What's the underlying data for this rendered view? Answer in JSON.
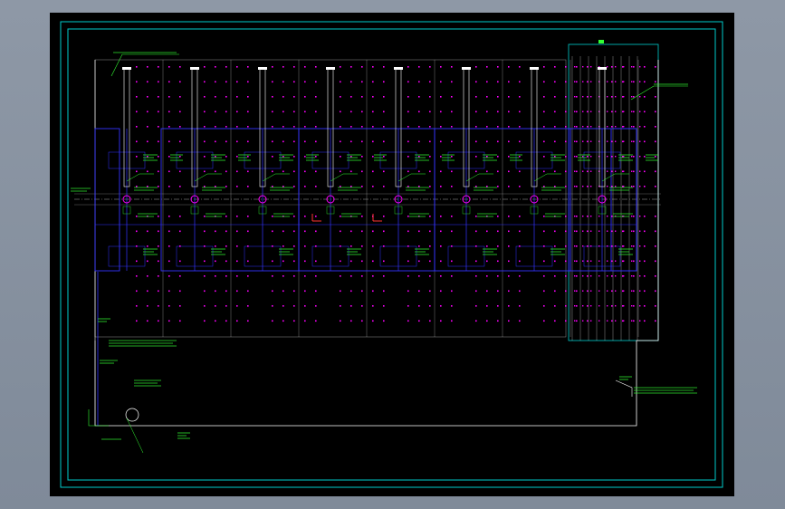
{
  "drawing": {
    "colors": {
      "background": "#000000",
      "frame": "#00cccc",
      "grid": "#ffffff",
      "pile": "#ff00ff",
      "wall": "#3333ff",
      "annotation": "#33ff33",
      "accent": "#ff3333",
      "axis": "#aaaaaa"
    },
    "bays": 8,
    "pile_rows": 18,
    "pile_cols_per_bay": 5,
    "icons": [
      "column-icon",
      "pile-dot-icon",
      "leader-line-icon"
    ]
  }
}
